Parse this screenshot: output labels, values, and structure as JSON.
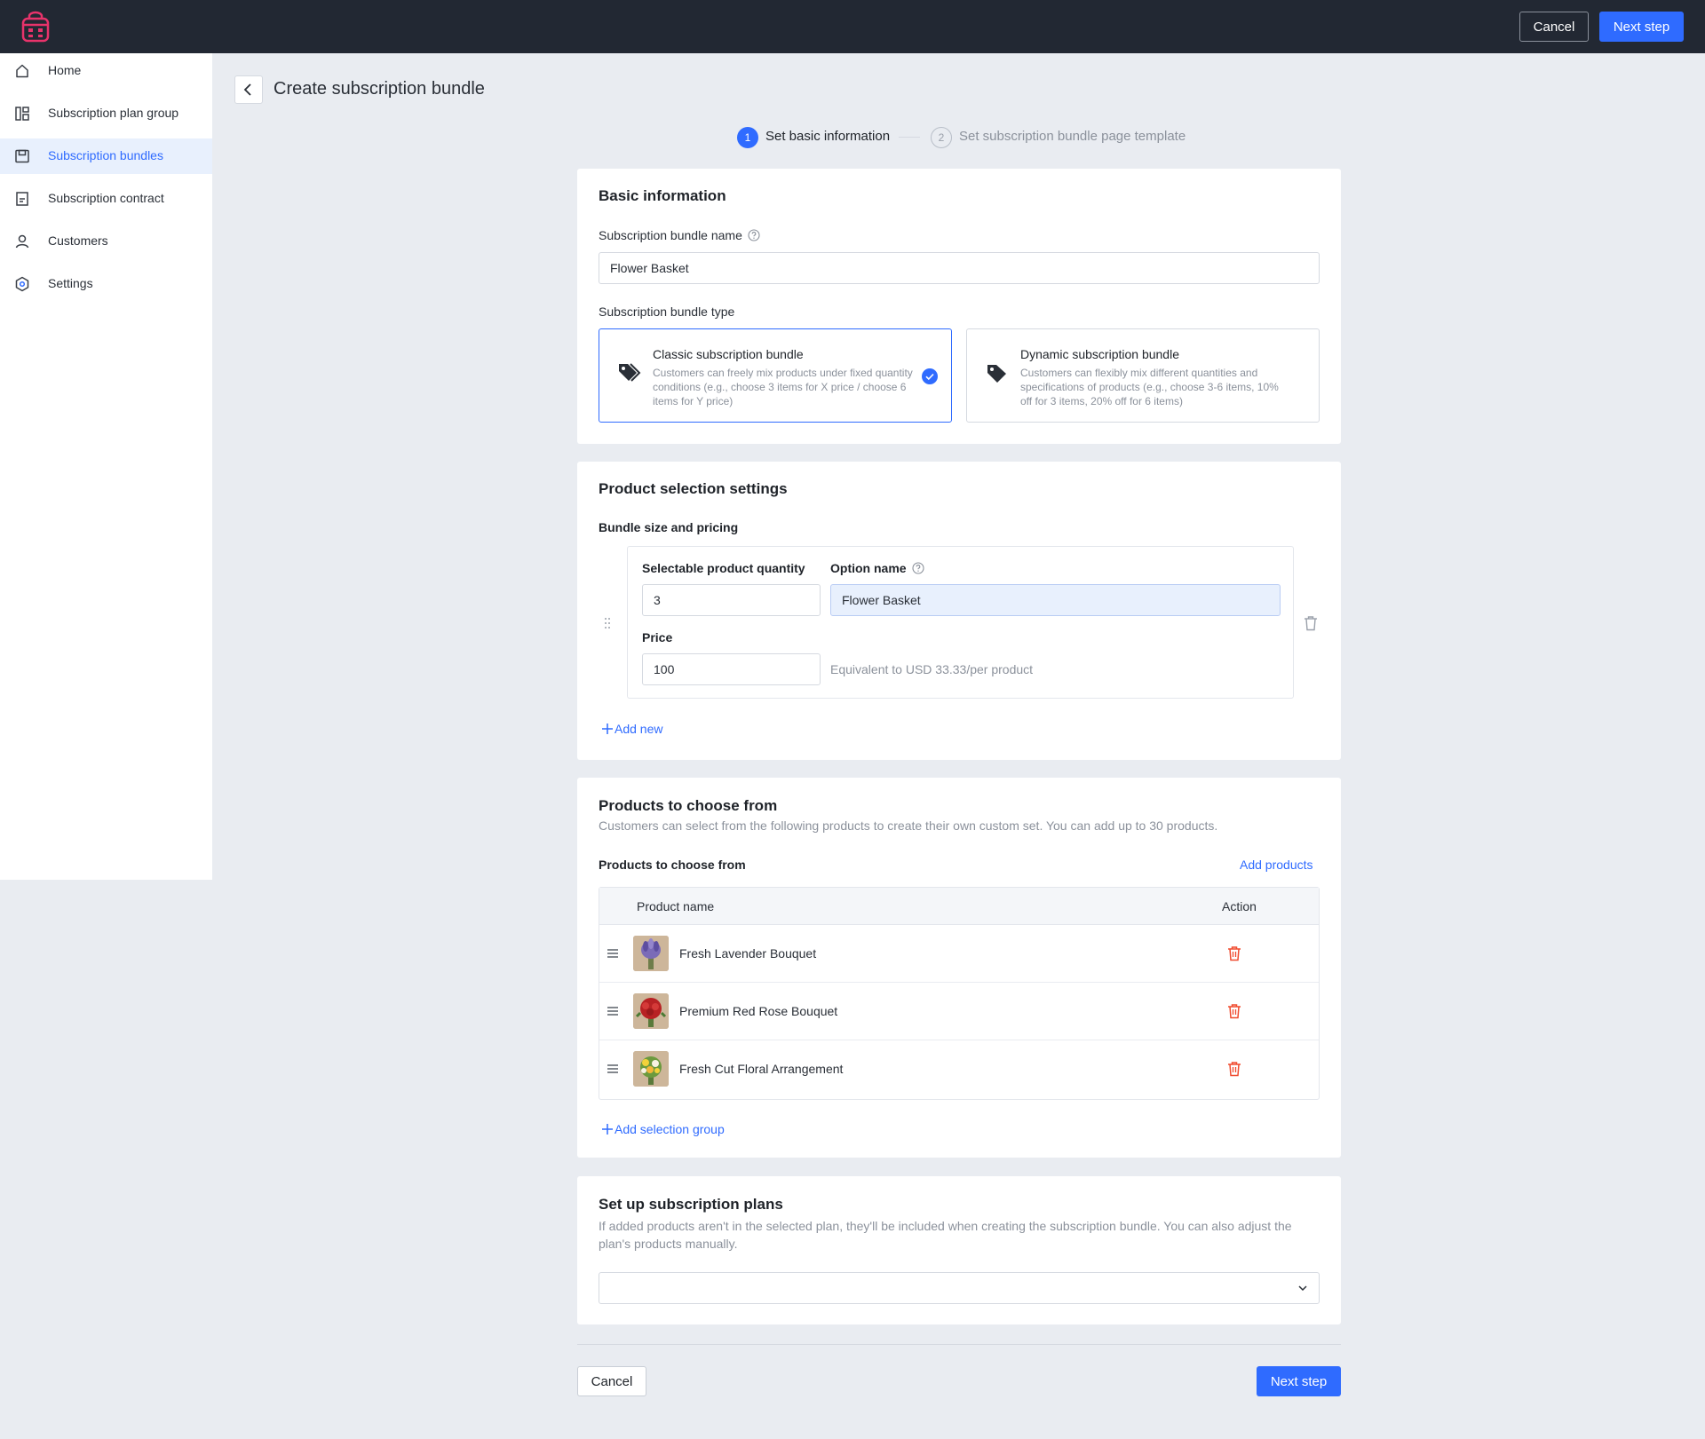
{
  "topbar": {
    "cancel_label": "Cancel",
    "next_label": "Next step"
  },
  "sidebar": {
    "items": [
      {
        "label": "Home",
        "icon": "home-icon",
        "active": false
      },
      {
        "label": "Subscription plan group",
        "icon": "layout-icon",
        "active": false
      },
      {
        "label": "Subscription bundles",
        "icon": "box-icon",
        "active": true
      },
      {
        "label": "Subscription contract",
        "icon": "document-icon",
        "active": false
      },
      {
        "label": "Customers",
        "icon": "user-icon",
        "active": false
      },
      {
        "label": "Settings",
        "icon": "settings-icon",
        "active": false
      }
    ]
  },
  "header": {
    "title": "Create subscription bundle"
  },
  "steps": [
    {
      "number": "1",
      "label": "Set basic information",
      "active": true
    },
    {
      "number": "2",
      "label": "Set subscription bundle page template",
      "active": false
    }
  ],
  "basic_info": {
    "title": "Basic information",
    "name_label": "Subscription bundle name",
    "name_value": "Flower Basket",
    "type_label": "Subscription bundle type",
    "types": [
      {
        "title": "Classic subscription bundle",
        "description": "Customers can freely mix products under fixed quantity conditions (e.g., choose 3 items for X price / choose 6 items for Y price)",
        "selected": true
      },
      {
        "title": "Dynamic subscription bundle",
        "description": "Customers can flexibly mix different quantities and specifications of products (e.g., choose 3-6 items, 10% off for 3 items, 20% off for 6 items)",
        "selected": false
      }
    ]
  },
  "product_selection": {
    "title": "Product selection settings",
    "subtitle": "Bundle size and pricing",
    "quantity_label": "Selectable product quantity",
    "quantity_value": "3",
    "option_name_label": "Option name",
    "option_name_value": "Flower Basket",
    "price_label": "Price",
    "price_value": "100",
    "equivalent_text": "Equivalent to USD 33.33/per product",
    "add_new_label": "Add new"
  },
  "products": {
    "title": "Products to choose from",
    "description": "Customers can select from the following products to create their own custom set. You can add up to 30 products.",
    "list_label": "Products to choose from",
    "add_products_label": "Add products",
    "columns": {
      "name": "Product name",
      "action": "Action"
    },
    "rows": [
      {
        "name": "Fresh Lavender Bouquet",
        "thumb_color": "#7b6bb8"
      },
      {
        "name": "Premium Red Rose Bouquet",
        "thumb_color": "#c0282a"
      },
      {
        "name": "Fresh Cut Floral Arrangement",
        "thumb_color": "#e7c63a"
      }
    ],
    "add_group_label": "Add selection group"
  },
  "plans": {
    "title": "Set up subscription plans",
    "description": "If added products aren't in the selected plan, they'll be included when creating the subscription bundle. You can also adjust the plan's products manually.",
    "select_value": ""
  },
  "footer": {
    "cancel_label": "Cancel",
    "next_label": "Next step"
  },
  "colors": {
    "accent": "#2f6bff",
    "topbar": "#222833",
    "logo": "#e8336b",
    "danger": "#f04a2e"
  }
}
